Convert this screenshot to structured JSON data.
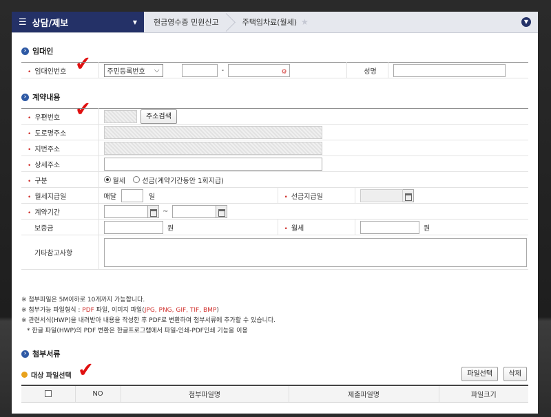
{
  "nav": {
    "title": "상담/제보",
    "crumbs": [
      "현금영수증 민원신고",
      "주택임차료(월세)"
    ]
  },
  "sections": {
    "landlord": "임대인",
    "contract": "계약내용",
    "attachments": "첨부서류"
  },
  "landlord": {
    "id_label": "임대인번호",
    "id_type": "주민등록번호",
    "dash": "-",
    "name_label": "성명"
  },
  "contract": {
    "zip_label": "우편번호",
    "zip_button": "주소검색",
    "road_label": "도로명주소",
    "lot_label": "지번주소",
    "detail_label": "상세주소",
    "type_label": "구분",
    "type_monthly": "월세",
    "type_prepaid": "선금(계약기간동안 1회지급)",
    "payday_label": "월세지급일",
    "payday_prefix": "매달",
    "payday_suffix": "일",
    "prepaid_date_label": "선금지급일",
    "period_label": "계약기간",
    "tilde": "~",
    "deposit_label": "보증금",
    "won": "원",
    "rent_label": "월세",
    "remarks_label": "기타참고사항"
  },
  "notes": {
    "line1": "※ 첨부파일은 5M이하로 10개까지 가능합니다.",
    "line2_prefix": "※ 첨부가능 파일형식 : ",
    "line2_pdf": "PDF",
    "line2_mid": " 파일, 이미지 파일(",
    "line2_img": "JPG, PNG, GIF, TIF, BMP",
    "line2_end": ")",
    "line3": "※ 관련서식(HWP)을 내려받아 내용을 작성한 후 PDF로 변환하여 첨부서류에 추가할 수 있습니다.",
    "line4": "* 한글 파일(HWP)의 PDF 변환은 한글프로그램에서 파일-인쇄-PDF인쇄 기능을 이용"
  },
  "attach": {
    "target_label": "대상 파일선택",
    "select_button": "파일선택",
    "delete_button": "삭제",
    "columns": [
      "NO",
      "첨부파일명",
      "제출파일명",
      "파일크기"
    ]
  },
  "colors": {
    "nav_dark": "#243167",
    "required": "#d0312d",
    "checkmark": "#e01010"
  }
}
